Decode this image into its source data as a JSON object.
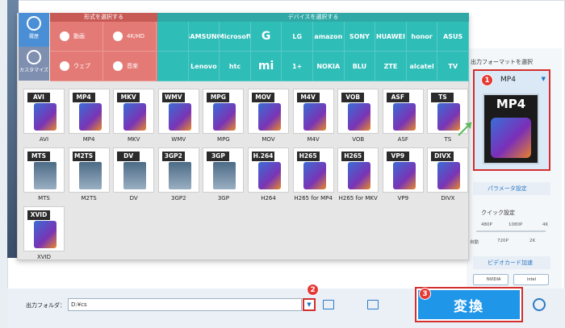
{
  "output_panel": {
    "title": "出力フォーマットを選択",
    "selected_format": "MP4",
    "icon_label": "MP4",
    "param_button": "パラメータ設定",
    "quick_setting": "クイック設定",
    "scale_top": [
      "480P",
      "1080P",
      "4K"
    ],
    "scale_bottom": [
      "自動",
      "720P",
      "2K"
    ],
    "gpu_button": "ビデオカード加速",
    "gpu_vendors": [
      "NVIDIA",
      "intel"
    ]
  },
  "popup": {
    "side_tabs": [
      "履歴",
      "カスタマイズ"
    ],
    "format_header": "形式を選択する",
    "device_header": "デバイスを選択する",
    "format_categories": [
      "動画",
      "4K/HD",
      "ウェブ",
      "音楽"
    ],
    "device_categories": [
      "",
      "SAMSUNG",
      "Microsoft",
      "G",
      "LG",
      "amazon",
      "SONY",
      "HUAWEI",
      "honor",
      "ASUS",
      "",
      "Lenovo",
      "htc",
      "mi",
      "1+",
      "NOKIA",
      "BLU",
      "ZTE",
      "alcatel",
      "TV"
    ],
    "formats": [
      {
        "tag": "AVI",
        "name": "AVI"
      },
      {
        "tag": "MP4",
        "name": "MP4"
      },
      {
        "tag": "MKV",
        "name": "MKV"
      },
      {
        "tag": "WMV",
        "name": "WMV"
      },
      {
        "tag": "MPG",
        "name": "MPG"
      },
      {
        "tag": "MOV",
        "name": "MOV"
      },
      {
        "tag": "M4V",
        "name": "M4V"
      },
      {
        "tag": "VOB",
        "name": "VOB"
      },
      {
        "tag": "ASF",
        "name": "ASF"
      },
      {
        "tag": "TS",
        "name": "TS"
      },
      {
        "tag": "MTS",
        "name": "MTS"
      },
      {
        "tag": "M2TS",
        "name": "M2TS"
      },
      {
        "tag": "DV",
        "name": "DV"
      },
      {
        "tag": "3GP2",
        "name": "3GP2"
      },
      {
        "tag": "3GP",
        "name": "3GP"
      },
      {
        "tag": "H.264",
        "name": "H264"
      },
      {
        "tag": "H265",
        "name": "H265 for MP4"
      },
      {
        "tag": "H265",
        "name": "H265 for MKV"
      },
      {
        "tag": "VP9",
        "name": "VP9"
      },
      {
        "tag": "DIVX",
        "name": "DIVX"
      },
      {
        "tag": "XVID",
        "name": "XVID"
      }
    ]
  },
  "bottom_bar": {
    "output_folder_label": "出力フォルダ：",
    "output_path": "D:¥cs",
    "convert_label": "変換"
  },
  "badges": [
    "1",
    "2",
    "3"
  ],
  "colors": {
    "format_header": "#c85a55",
    "device_header": "#2fa8a6",
    "convert_button": "#1f96e8",
    "highlight": "#d32f2f"
  }
}
